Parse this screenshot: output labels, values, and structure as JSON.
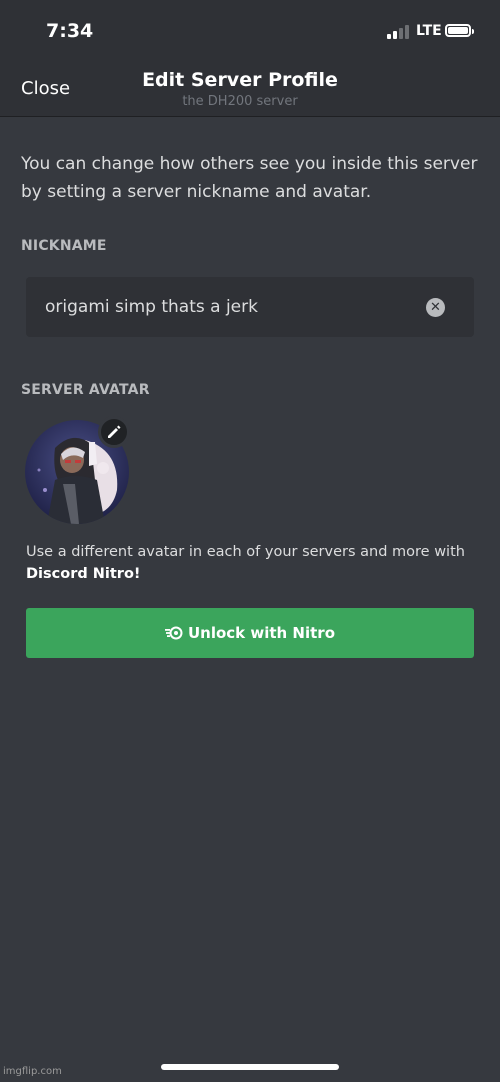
{
  "status_bar": {
    "time": "7:34",
    "network": "LTE",
    "signal_icon": "signal-bars-icon",
    "battery_icon": "battery-icon"
  },
  "header": {
    "close_label": "Close",
    "title": "Edit Server Profile",
    "subtitle": "the DH200 server"
  },
  "intro_text": "You can change how others see you inside this server by setting a server nickname and avatar.",
  "nickname": {
    "label": "NICKNAME",
    "value": "origami simp thats a jerk",
    "clear_icon": "clear-icon"
  },
  "server_avatar": {
    "label": "SERVER AVATAR",
    "edit_icon": "pencil-icon"
  },
  "nitro": {
    "description": "Use a different avatar in each of your servers and more with ",
    "description_bold": "Discord Nitro!",
    "button_label": "Unlock with Nitro",
    "button_icon": "nitro-icon"
  },
  "watermark": "imgflip.com",
  "colors": {
    "background": "#36393f",
    "header_background": "#2f3136",
    "input_background": "#2f3136",
    "nitro_button": "#3ba55c",
    "label_text": "#b9bbbe",
    "subtitle_text": "#72767d"
  }
}
